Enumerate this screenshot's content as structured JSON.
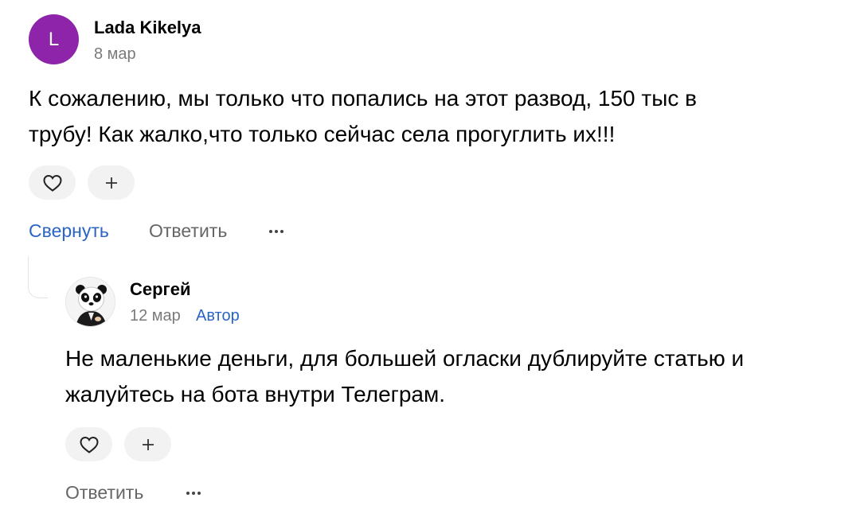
{
  "comment": {
    "avatar_letter": "L",
    "author": "Lada Kikelya",
    "date": "8 мар",
    "text_line1": "К сожалению, мы только что попались на этот развод, 150 тыс в",
    "text_line2": "трубу! Как жалко,что только сейчас села прогуглить их!!!",
    "collapse_label": "Свернуть",
    "reply_label": "Ответить"
  },
  "reply": {
    "author": "Сергей",
    "date": "12 мар",
    "badge": "Автор",
    "text_line1": "Не маленькие деньги, для большей огласки дублируйте статью и",
    "text_line2": "жалуйтесь на бота внутри Телеграм.",
    "reply_label": "Ответить"
  },
  "icons": {
    "like": "heart-icon",
    "add_reaction": "plus-icon",
    "more": "more-dots-icon",
    "avatar": "panda-avatar"
  },
  "colors": {
    "avatar_bg": "#8e24aa",
    "link": "#2a64c5",
    "secondary_text": "#7a7a7a",
    "pill_bg": "#f2f2f2"
  }
}
